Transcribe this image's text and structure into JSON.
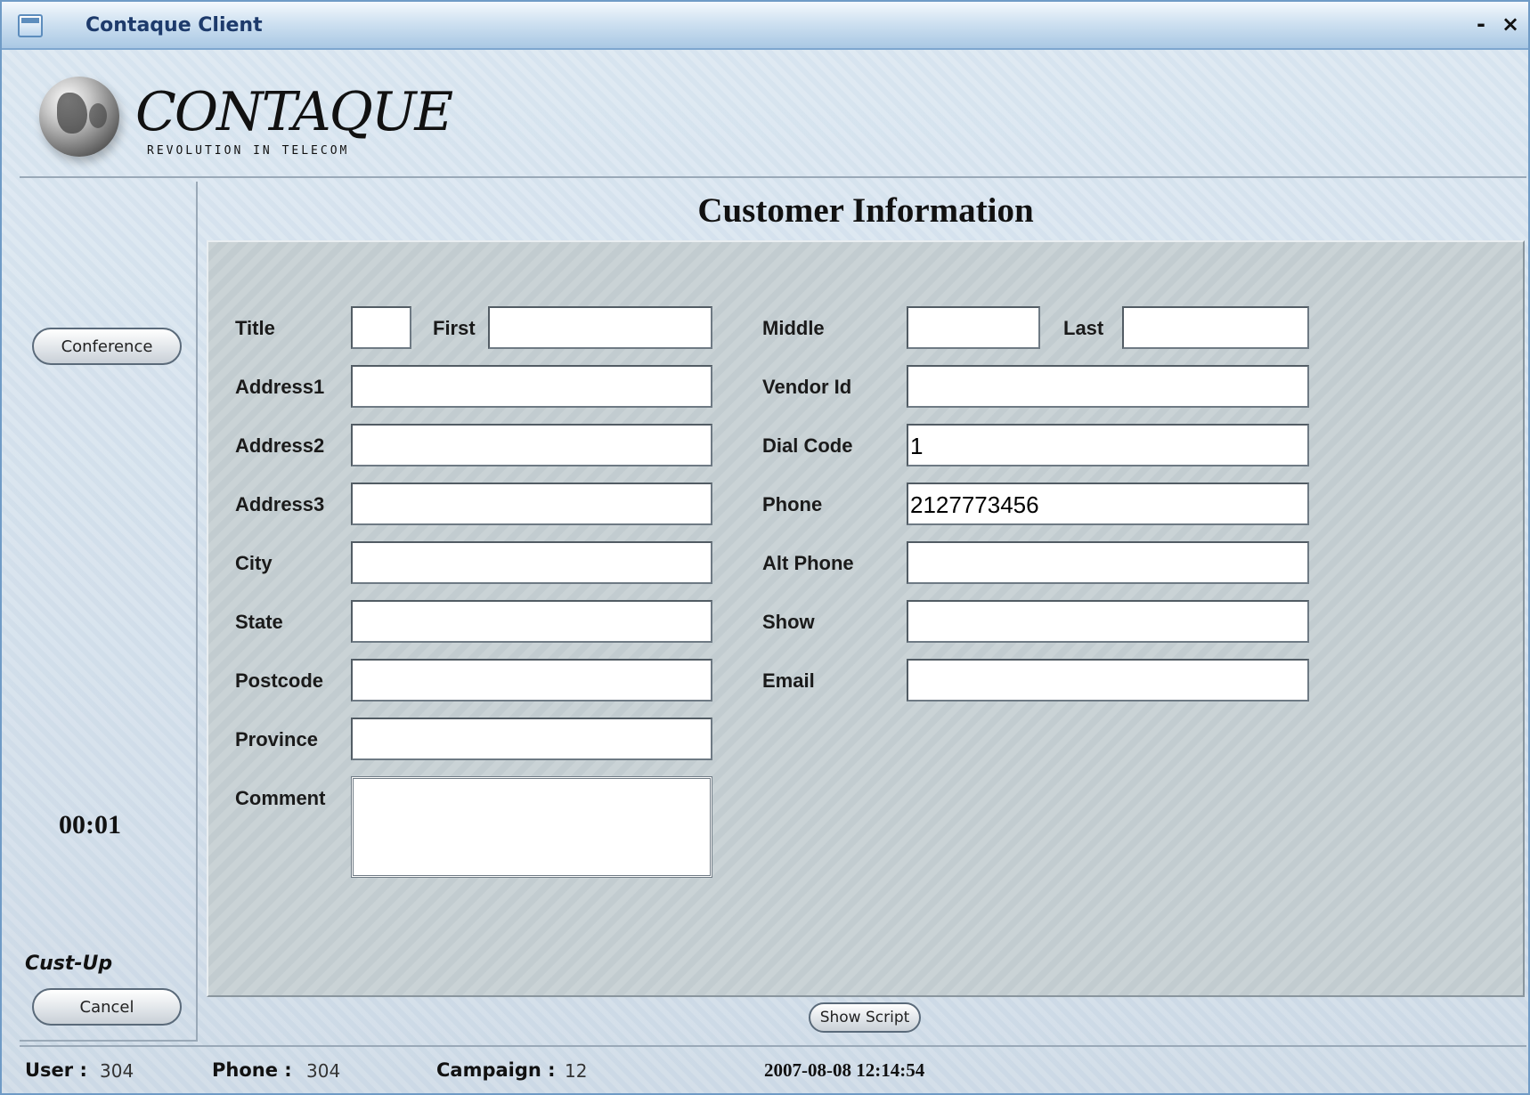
{
  "window": {
    "title": "Contaque Client",
    "minimize_label": "-",
    "close_label": "×"
  },
  "logo": {
    "wordmark": "CONTAQUE",
    "tagline": "REVOLUTION IN TELECOM"
  },
  "page_title": "Customer Information",
  "left_panel": {
    "conference_label": "Conference",
    "timer": "00:01",
    "status": "Cust-Up",
    "cancel_label": "Cancel"
  },
  "form": {
    "title": {
      "label": "Title",
      "value": ""
    },
    "first": {
      "label": "First",
      "value": ""
    },
    "middle": {
      "label": "Middle",
      "value": ""
    },
    "last": {
      "label": "Last",
      "value": ""
    },
    "address1": {
      "label": "Address1",
      "value": ""
    },
    "address2": {
      "label": "Address2",
      "value": ""
    },
    "address3": {
      "label": "Address3",
      "value": ""
    },
    "city": {
      "label": "City",
      "value": ""
    },
    "state": {
      "label": "State",
      "value": ""
    },
    "postcode": {
      "label": "Postcode",
      "value": ""
    },
    "province": {
      "label": "Province",
      "value": ""
    },
    "comment": {
      "label": "Comment",
      "value": ""
    },
    "vendor_id": {
      "label": "Vendor Id",
      "value": ""
    },
    "dial_code": {
      "label": "Dial Code",
      "value": "1"
    },
    "phone": {
      "label": "Phone",
      "value": "2127773456"
    },
    "alt_phone": {
      "label": "Alt Phone",
      "value": ""
    },
    "show": {
      "label": "Show",
      "value": ""
    },
    "email": {
      "label": "Email",
      "value": ""
    }
  },
  "show_script_label": "Show Script",
  "status_bar": {
    "user_label": "User :",
    "user_value": "304",
    "phone_label": "Phone :",
    "phone_value": "304",
    "campaign_label": "Campaign :",
    "campaign_value": "12",
    "datetime": "2007-08-08 12:14:54"
  }
}
